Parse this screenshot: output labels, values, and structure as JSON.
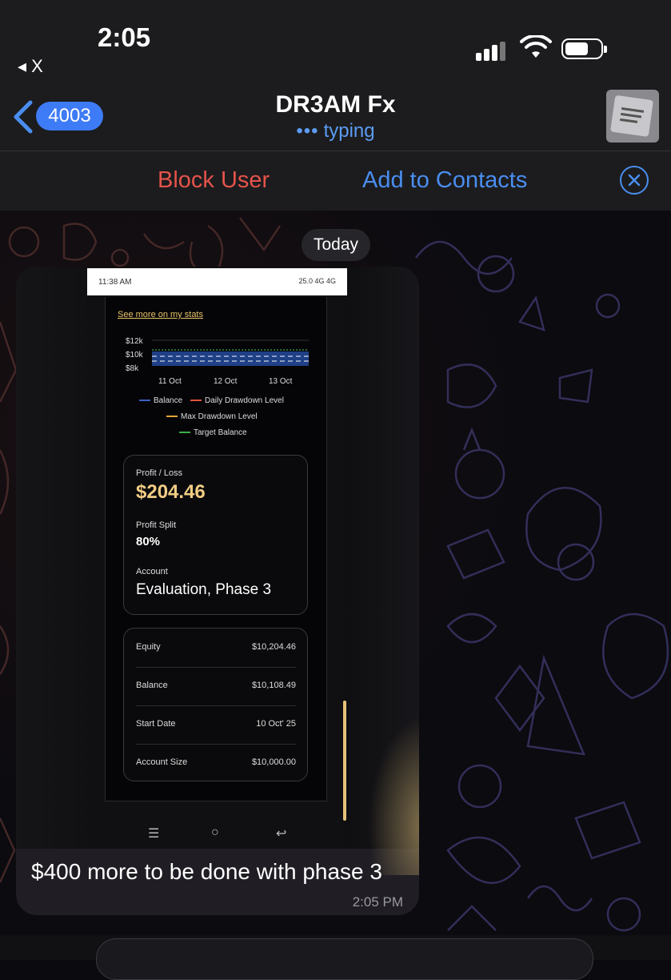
{
  "status_bar": {
    "time": "2:05",
    "back_app": "◂ X"
  },
  "header": {
    "unread_count": "4003",
    "title": "DR3AM Fx",
    "status": "typing"
  },
  "actions": {
    "block": "Block User",
    "add": "Add to Contacts"
  },
  "date_separator": "Today",
  "message": {
    "caption": "$400 more to be done with phase 3",
    "time": "2:05 PM",
    "screenshot": {
      "status_time": "11:38 AM",
      "status_right": "25.0 4G 4G",
      "link": "See more on my stats",
      "chart_data": {
        "type": "line",
        "y_ticks": [
          "$12k",
          "$10k",
          "$8k"
        ],
        "x_ticks": [
          "11 Oct",
          "12 Oct",
          "13 Oct"
        ],
        "legend": [
          "Balance",
          "Daily Drawdown Level",
          "Max Drawdown Level",
          "Target Balance"
        ],
        "colors": {
          "Balance": "#3b5fc4",
          "Daily Drawdown Level": "#e0533b",
          "Max Drawdown Level": "#e8a23a",
          "Target Balance": "#3fae4a"
        }
      },
      "summary": {
        "pl_label": "Profit / Loss",
        "pl_value": "$204.46",
        "split_label": "Profit Split",
        "split_value": "80%",
        "account_label": "Account",
        "account_value": "Evaluation, Phase 3"
      },
      "details": [
        {
          "k": "Equity",
          "v": "$10,204.46"
        },
        {
          "k": "Balance",
          "v": "$10,108.49"
        },
        {
          "k": "Start Date",
          "v": "10 Oct' 25"
        },
        {
          "k": "Account Size",
          "v": "$10,000.00"
        }
      ]
    }
  }
}
